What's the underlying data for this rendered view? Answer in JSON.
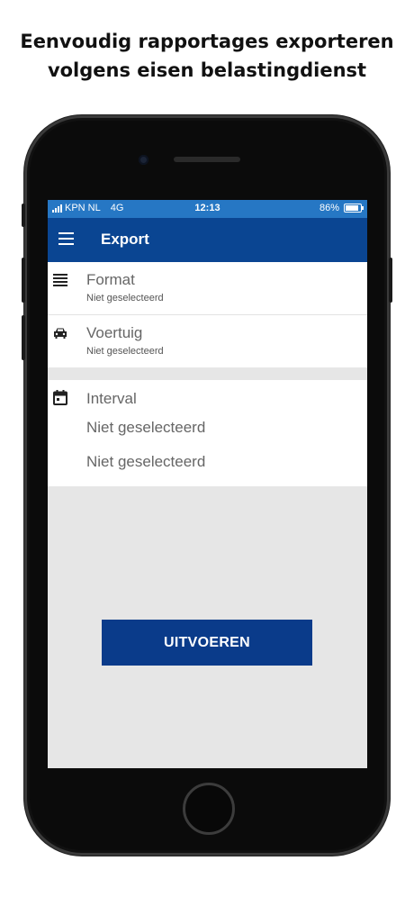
{
  "headline": {
    "line1": "Eenvoudig rapportages exporteren",
    "line2": "volgens eisen belastingdienst"
  },
  "status_bar": {
    "carrier": "KPN NL",
    "network": "4G",
    "time": "12:13",
    "battery": "86%",
    "battery_level": 0.86
  },
  "app_bar": {
    "title": "Export",
    "menu_icon": "menu-icon"
  },
  "fields": [
    {
      "label": "Format",
      "value": "Niet geselecteerd",
      "icon": "list-icon"
    },
    {
      "label": "Voertuig",
      "value": "Niet geselecteerd",
      "icon": "car-icon"
    }
  ],
  "interval": {
    "label": "Interval",
    "icon": "calendar-icon",
    "start": "Niet geselecteerd",
    "end": "Niet geselecteerd"
  },
  "action": {
    "label": "UITVOEREN"
  },
  "colors": {
    "status_bar": "#2677c4",
    "app_bar": "#0a4592",
    "button": "#0a3b8a",
    "background": "#e6e6e6"
  }
}
